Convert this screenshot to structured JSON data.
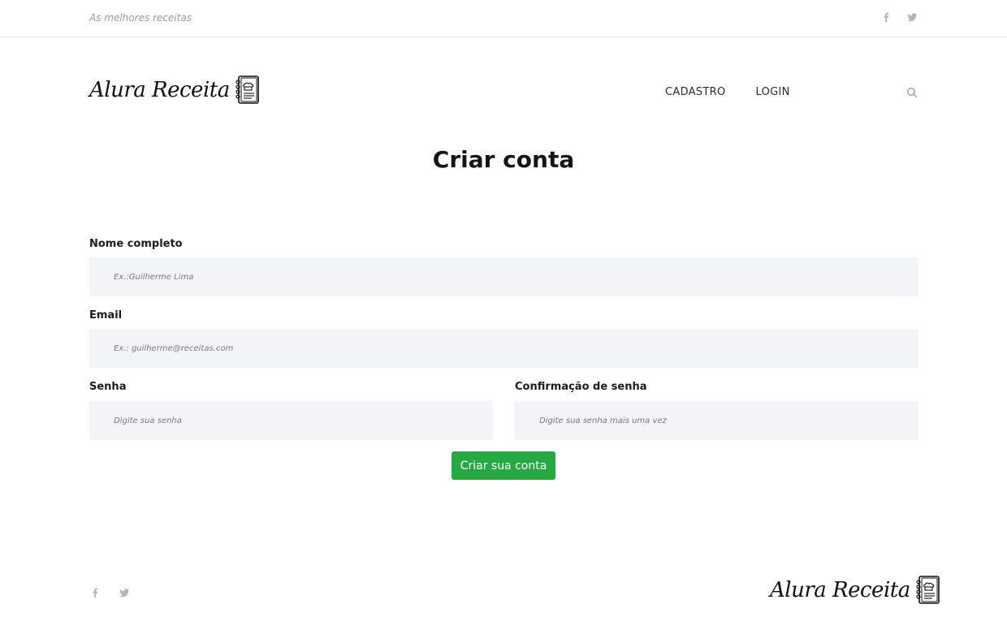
{
  "topbar": {
    "tagline": "As melhores receitas"
  },
  "social": {
    "facebook_icon": "facebook-icon",
    "twitter_icon": "twitter-icon"
  },
  "brand": {
    "name": "Alura Receita",
    "icon": "recipe-book-icon"
  },
  "nav": {
    "items": [
      {
        "label": "CADASTRO"
      },
      {
        "label": "LOGIN"
      }
    ],
    "search_icon": "search-icon"
  },
  "page": {
    "title": "Criar conta"
  },
  "form": {
    "name": {
      "label": "Nome completo",
      "placeholder": "Ex.:Guilherme Lima",
      "value": ""
    },
    "email": {
      "label": "Email",
      "placeholder": "Ex.: guilherme@receitas.com",
      "value": ""
    },
    "password": {
      "label": "Senha",
      "placeholder": "Digite sua senha",
      "value": ""
    },
    "password_confirm": {
      "label": "Confirmação de senha",
      "placeholder": "Digite sua senha mais uma vez",
      "value": ""
    },
    "submit_label": "Criar sua conta"
  },
  "colors": {
    "accent": "#28a745",
    "field_bg": "#f3f4f7",
    "muted": "#9a9a9a"
  }
}
